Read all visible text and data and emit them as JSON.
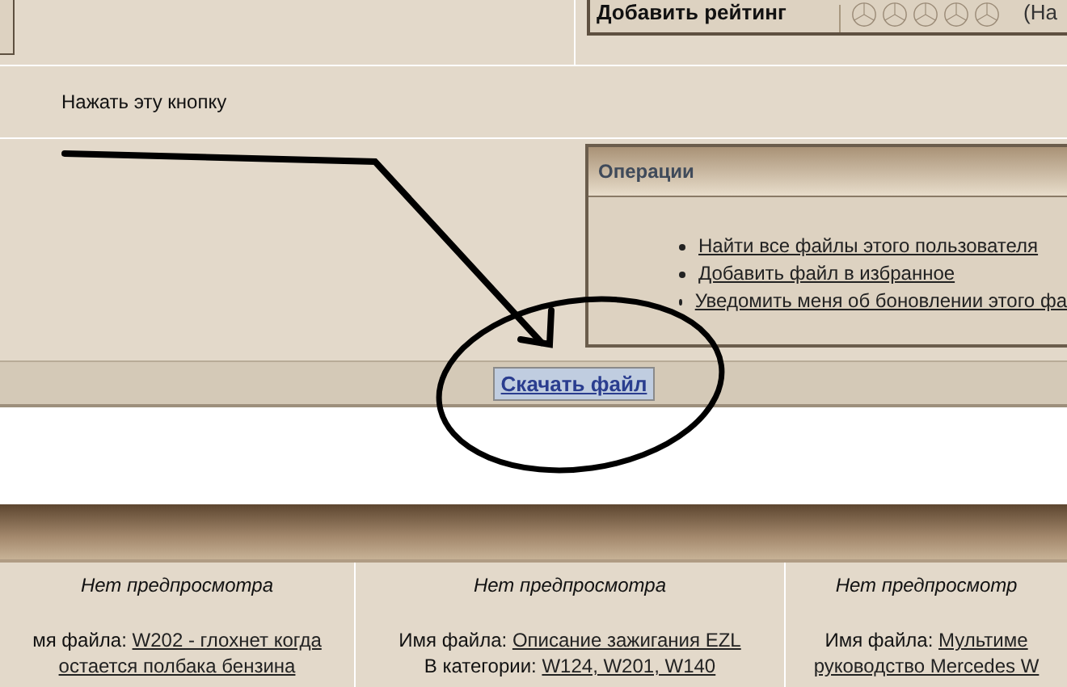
{
  "rating": {
    "label": "Добавить рейтинг",
    "stars": 0,
    "note": "(На"
  },
  "instruction": "Нажать эту кнопку",
  "operations": {
    "title": "Операции",
    "links": [
      "Найти все файлы этого пользователя",
      "Добавить файл в избранное",
      "Уведомить меня об боновлении этого фа"
    ]
  },
  "download_button": "Скачать файл",
  "files": [
    {
      "preview": "Нет предпросмотра",
      "name_label": "мя файла:",
      "name_lines": [
        "W202 - глохнет когда",
        "остается полбака бензина"
      ]
    },
    {
      "preview": "Нет предпросмотра",
      "name_label": "Имя файла:",
      "name_lines": [
        "Описание зажигания EZL"
      ],
      "category_label": "В категории:",
      "category": "W124, W201, W140"
    },
    {
      "preview": "Нет предпросмотр",
      "name_label": "Имя файла:",
      "name_lines": [
        "Мультиме",
        "руководство Mercedes W"
      ]
    }
  ]
}
